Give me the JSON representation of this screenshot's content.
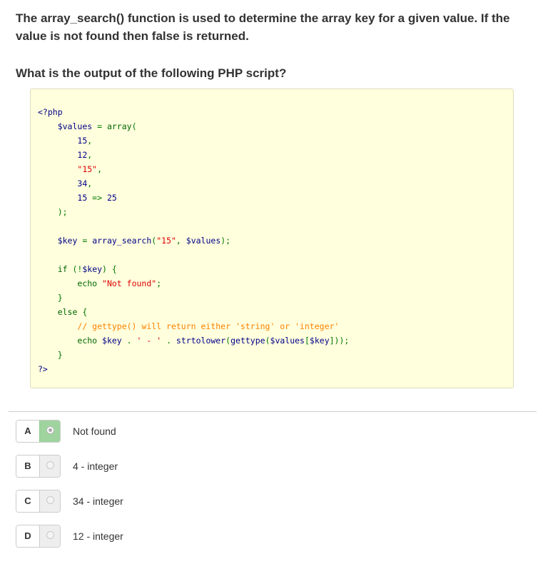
{
  "question": {
    "text": "The array_search() function is used to determine the array key for a given value. If the value is not found then false is returned.",
    "prompt": "What is the output of the following PHP script?"
  },
  "code": {
    "lines": [
      [
        {
          "t": "<?php",
          "c": "pl"
        }
      ],
      [
        {
          "t": "    ",
          "c": ""
        },
        {
          "t": "$values",
          "c": "var"
        },
        {
          "t": " = ",
          "c": "ops"
        },
        {
          "t": "array",
          "c": "kw"
        },
        {
          "t": "(",
          "c": "ops"
        }
      ],
      [
        {
          "t": "        ",
          "c": ""
        },
        {
          "t": "15",
          "c": "num"
        },
        {
          "t": ",",
          "c": "ops"
        }
      ],
      [
        {
          "t": "        ",
          "c": ""
        },
        {
          "t": "12",
          "c": "num"
        },
        {
          "t": ",",
          "c": "ops"
        }
      ],
      [
        {
          "t": "        ",
          "c": ""
        },
        {
          "t": "\"15\"",
          "c": "str"
        },
        {
          "t": ",",
          "c": "ops"
        }
      ],
      [
        {
          "t": "        ",
          "c": ""
        },
        {
          "t": "34",
          "c": "num"
        },
        {
          "t": ",",
          "c": "ops"
        }
      ],
      [
        {
          "t": "        ",
          "c": ""
        },
        {
          "t": "15",
          "c": "num"
        },
        {
          "t": " => ",
          "c": "ops"
        },
        {
          "t": "25",
          "c": "num"
        }
      ],
      [
        {
          "t": "    ",
          "c": ""
        },
        {
          "t": ");",
          "c": "ops"
        }
      ],
      [
        {
          "t": "",
          "c": ""
        }
      ],
      [
        {
          "t": "    ",
          "c": ""
        },
        {
          "t": "$key",
          "c": "var"
        },
        {
          "t": " = ",
          "c": "ops"
        },
        {
          "t": "array_search",
          "c": "fn"
        },
        {
          "t": "(",
          "c": "ops"
        },
        {
          "t": "\"15\"",
          "c": "str"
        },
        {
          "t": ", ",
          "c": "ops"
        },
        {
          "t": "$values",
          "c": "var"
        },
        {
          "t": ");",
          "c": "ops"
        }
      ],
      [
        {
          "t": "",
          "c": ""
        }
      ],
      [
        {
          "t": "    ",
          "c": ""
        },
        {
          "t": "if",
          "c": "kw"
        },
        {
          "t": " (!",
          "c": "ops"
        },
        {
          "t": "$key",
          "c": "var"
        },
        {
          "t": ") {",
          "c": "ops"
        }
      ],
      [
        {
          "t": "        ",
          "c": ""
        },
        {
          "t": "echo",
          "c": "kw"
        },
        {
          "t": " ",
          "c": ""
        },
        {
          "t": "\"Not found\"",
          "c": "str"
        },
        {
          "t": ";",
          "c": "ops"
        }
      ],
      [
        {
          "t": "    ",
          "c": ""
        },
        {
          "t": "}",
          "c": "ops"
        }
      ],
      [
        {
          "t": "    ",
          "c": ""
        },
        {
          "t": "else",
          "c": "kw"
        },
        {
          "t": " {",
          "c": "ops"
        }
      ],
      [
        {
          "t": "        ",
          "c": ""
        },
        {
          "t": "// gettype() will return either 'string' or 'integer'",
          "c": "cm"
        }
      ],
      [
        {
          "t": "        ",
          "c": ""
        },
        {
          "t": "echo",
          "c": "kw"
        },
        {
          "t": " ",
          "c": ""
        },
        {
          "t": "$key",
          "c": "var"
        },
        {
          "t": " . ",
          "c": "ops"
        },
        {
          "t": "' - '",
          "c": "str"
        },
        {
          "t": " . ",
          "c": "ops"
        },
        {
          "t": "strtolower",
          "c": "fn"
        },
        {
          "t": "(",
          "c": "ops"
        },
        {
          "t": "gettype",
          "c": "fn"
        },
        {
          "t": "(",
          "c": "ops"
        },
        {
          "t": "$values",
          "c": "var"
        },
        {
          "t": "[",
          "c": "ops"
        },
        {
          "t": "$key",
          "c": "var"
        },
        {
          "t": "]));",
          "c": "ops"
        }
      ],
      [
        {
          "t": "    ",
          "c": ""
        },
        {
          "t": "}",
          "c": "ops"
        }
      ],
      [
        {
          "t": "?>",
          "c": "pl"
        }
      ]
    ]
  },
  "options": [
    {
      "letter": "A",
      "text": "Not found",
      "selected": true
    },
    {
      "letter": "B",
      "text": "4 - integer",
      "selected": false
    },
    {
      "letter": "C",
      "text": "34 - integer",
      "selected": false
    },
    {
      "letter": "D",
      "text": "12 - integer",
      "selected": false
    }
  ],
  "colors": {
    "code_background": "#ffffdd",
    "selected_radio_cell": "#9fd49f",
    "keyword": "#006600",
    "variable": "#000088",
    "string": "#dd0000",
    "comment": "#ff8000"
  }
}
